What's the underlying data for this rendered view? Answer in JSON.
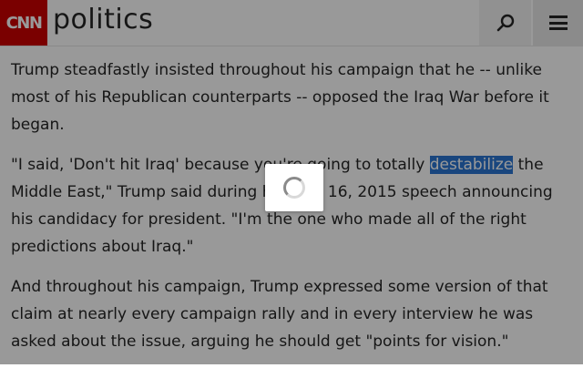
{
  "header": {
    "logo_text": "CNN",
    "section_title": "politics",
    "search_icon": "search-icon",
    "menu_icon": "hamburger-menu-icon"
  },
  "article": {
    "paragraphs": [
      "Trump steadfastly insisted throughout his campaign that he -- unlike most of his Republican counterparts -- opposed the Iraq War before it began.",
      {
        "before": "\"I said, 'Don't hit Iraq' because you're going to totally ",
        "highlighted": "destabilize",
        "after": " the Middle East,\" Trump said during his June 16, 2015 speech announcing his candidacy for president. \"I'm the one who made all of the right predictions about Iraq.\""
      },
      "And throughout his campaign, Trump expressed some version of that claim at nearly every campaign rally and in every interview he was asked about the issue, arguing he should get \"points for vision.\""
    ]
  },
  "overlay": {
    "spinner_icon": "loading-spinner-icon"
  },
  "colors": {
    "brand": "#cc0000",
    "selection": "#2a76d2",
    "text": "#262626"
  }
}
